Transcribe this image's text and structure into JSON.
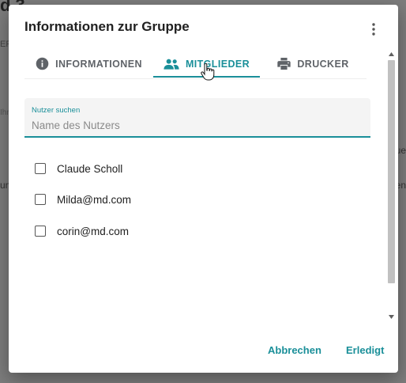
{
  "background": {
    "heading_fragment": "d 3",
    "er_fragment": "ER",
    "ihr_fragment": "Ihr",
    "ue_fragment": "ue",
    "un_fragment": "un",
    "en_fragment": "en"
  },
  "dialog": {
    "title": "Informationen zur Gruppe",
    "more_icon": "more-vert-icon"
  },
  "tabs": [
    {
      "label": "INFORMATIONEN",
      "icon": "info-icon",
      "active": false
    },
    {
      "label": "MITGLIEDER",
      "icon": "group-icon",
      "active": true
    },
    {
      "label": "DRUCKER",
      "icon": "printer-icon",
      "active": false
    }
  ],
  "search": {
    "label": "Nutzer suchen",
    "placeholder": "Name des Nutzers",
    "value": ""
  },
  "members": [
    {
      "label": "Claude Scholl",
      "checked": false
    },
    {
      "label": "Milda@md.com",
      "checked": false
    },
    {
      "label": "corin@md.com",
      "checked": false
    }
  ],
  "actions": {
    "cancel_label": "Abbrechen",
    "done_label": "Erledigt"
  },
  "colors": {
    "accent": "#1a8f99",
    "text": "#212121",
    "muted": "#5f6368",
    "backdrop": "#7d7d7d"
  }
}
